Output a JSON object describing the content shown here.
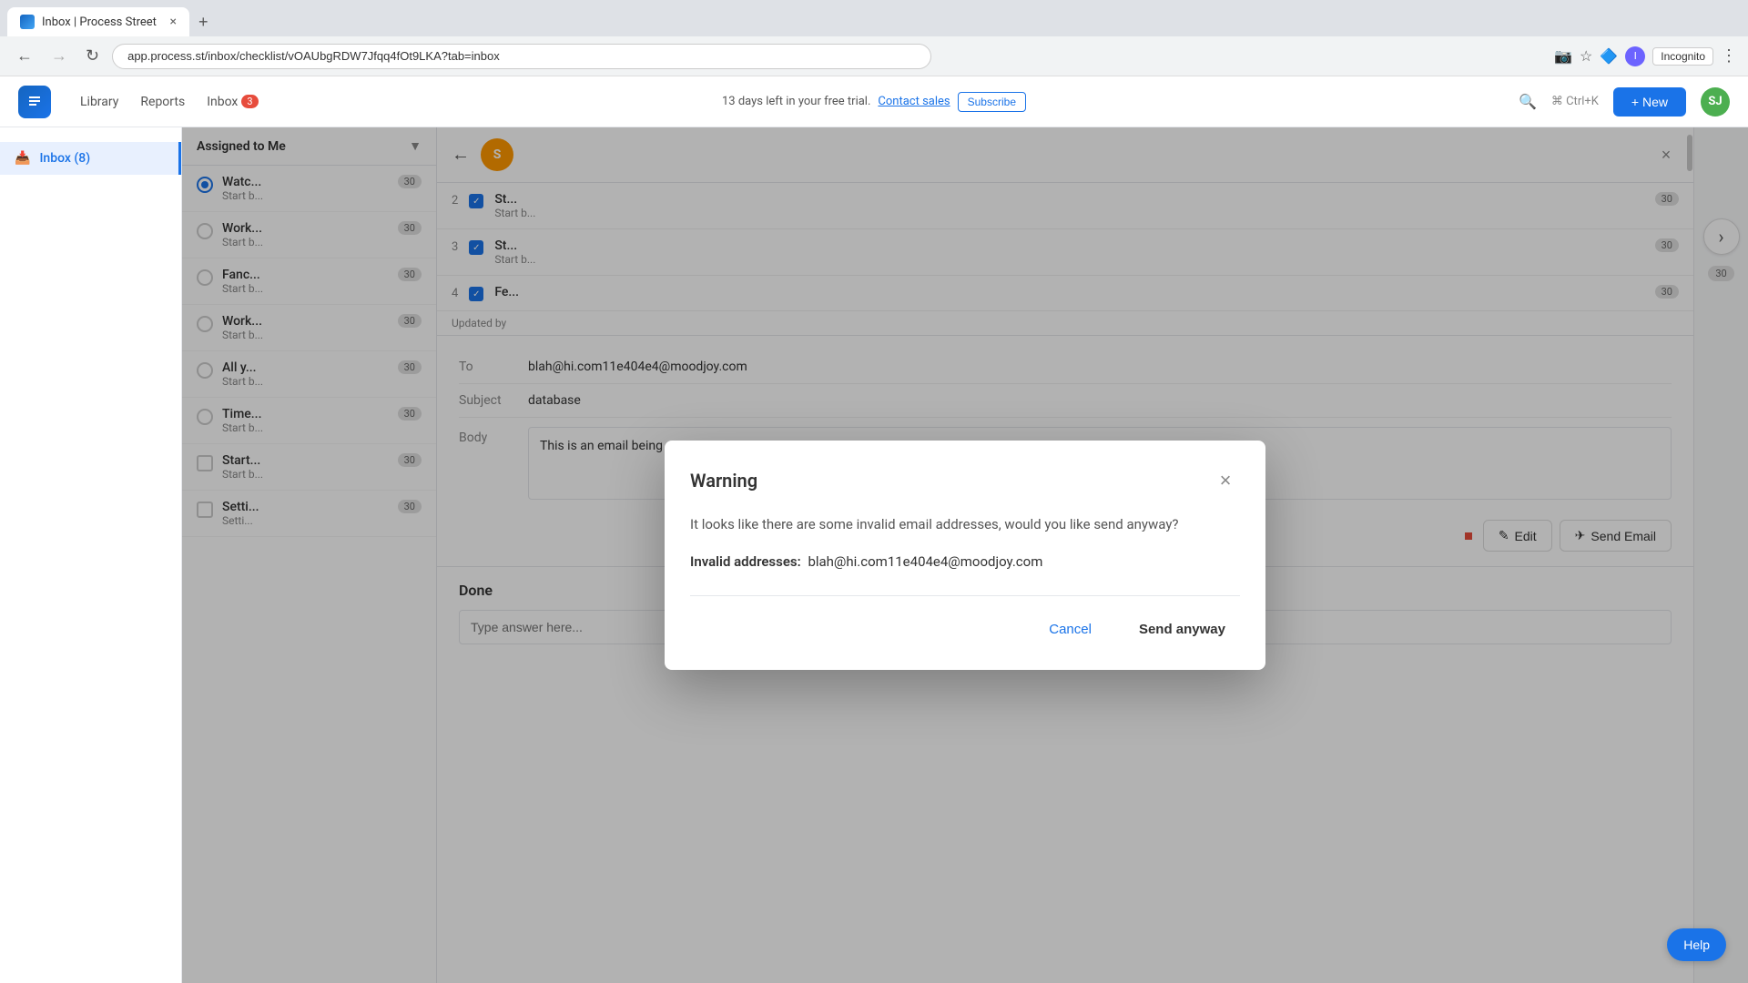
{
  "browser": {
    "tab_title": "Inbox | Process Street",
    "tab_close": "×",
    "new_tab": "+",
    "back": "←",
    "forward": "→",
    "refresh": "↻",
    "address": "app.process.st/inbox/checklist/vOAUbgRDW7Jfqq4fOt9LKA?tab=inbox",
    "incognito_label": "Incognito",
    "menu": "⋮"
  },
  "header": {
    "library": "Library",
    "reports": "Reports",
    "inbox": "Inbox",
    "inbox_count": "3",
    "trial_text": "13 days left in your free trial.",
    "contact_sales": "Contact sales",
    "subscribe": "Subscribe",
    "search_hint": "⌘ Ctrl+K",
    "new_label": "+ New",
    "avatar_initials": "SJ"
  },
  "sidebar": {
    "inbox_label": "Inbox (8)"
  },
  "task_panel": {
    "back_icon": "←",
    "avatar_initials": "S",
    "close_icon": "×",
    "tasks": [
      {
        "num": "2",
        "title": "St...",
        "subtitle": "Start b...",
        "checked": true,
        "badge": "30"
      },
      {
        "num": "3",
        "title": "St...",
        "subtitle": "Start b...",
        "checked": true,
        "badge": "30"
      },
      {
        "num": "4",
        "title": "Fe...",
        "subtitle": "",
        "checked": true,
        "badge": "30"
      }
    ],
    "updated_by": "Updated by",
    "inbox_items": [
      {
        "title": "Watc...",
        "subtitle": "Start b...",
        "badge": "30",
        "type": "circle"
      },
      {
        "title": "Work...",
        "subtitle": "Start b...",
        "badge": "30",
        "type": "circle"
      },
      {
        "title": "Fanc...",
        "subtitle": "Start b...",
        "badge": "30",
        "type": "circle"
      },
      {
        "title": "Work...",
        "subtitle": "Start b...",
        "badge": "30",
        "type": "circle"
      },
      {
        "title": "All y...",
        "subtitle": "Start b...",
        "badge": "30",
        "type": "circle"
      },
      {
        "title": "Time...",
        "subtitle": "Start b...",
        "badge": "30",
        "type": "circle"
      },
      {
        "title": "Start...",
        "subtitle": "Start b...",
        "badge": "30",
        "type": "list"
      },
      {
        "title": "Setti...",
        "subtitle": "Setti...",
        "badge": "30",
        "type": "list"
      }
    ]
  },
  "email_form": {
    "to_label": "To",
    "to_value": "blah@hi.com11e404e4@moodjoy.com",
    "subject_label": "Subject",
    "subject_value": "database",
    "body_label": "Body",
    "body_value": "This is an email being sent",
    "edit_label": "Edit",
    "send_email_label": "Send Email"
  },
  "done_section": {
    "label": "Done",
    "placeholder": "Type answer here..."
  },
  "right_panel": {
    "arrow": "›",
    "badge": "30"
  },
  "warning_dialog": {
    "title": "Warning",
    "close_icon": "×",
    "message": "It looks like there are some invalid email addresses, would you like send anyway?",
    "invalid_label": "Invalid addresses:",
    "invalid_addresses": "blah@hi.com11e404e4@moodjoy.com",
    "cancel_label": "Cancel",
    "send_anyway_label": "Send anyway"
  },
  "help_label": "Help",
  "colors": {
    "primary_blue": "#1a73e8",
    "accent_orange": "#ff9800",
    "sidebar_active_bg": "#e8f0fe"
  }
}
